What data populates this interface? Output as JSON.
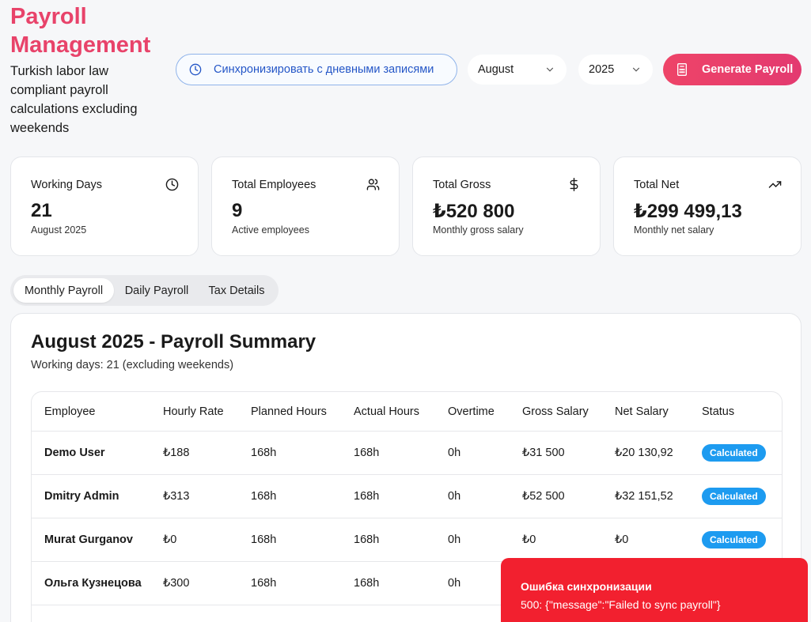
{
  "header": {
    "title": "Payroll Management",
    "subtitle": "Turkish labor law compliant payroll calculations excluding weekends",
    "sync_label": "Синхронизировать с дневными записями",
    "month": "August",
    "year": "2025",
    "generate_label": "Generate Payroll",
    "accent_color": "#e8436a"
  },
  "stats": [
    {
      "label": "Working Days",
      "value": "21",
      "sub": "August 2025",
      "icon": "clock-icon"
    },
    {
      "label": "Total Employees",
      "value": "9",
      "sub": "Active employees",
      "icon": "users-icon"
    },
    {
      "label": "Total Gross",
      "value": "₺520 800",
      "sub": "Monthly gross salary",
      "icon": "dollar-icon"
    },
    {
      "label": "Total Net",
      "value": "₺299 499,13",
      "sub": "Monthly net salary",
      "icon": "trending-up-icon"
    }
  ],
  "tabs": [
    "Monthly Payroll",
    "Daily Payroll",
    "Tax Details"
  ],
  "summary": {
    "title": "August 2025 - Payroll Summary",
    "subtitle": "Working days: 21 (excluding weekends)",
    "columns": [
      "Employee",
      "Hourly Rate",
      "Planned Hours",
      "Actual Hours",
      "Overtime",
      "Gross Salary",
      "Net Salary",
      "Status"
    ],
    "rows": [
      [
        "Demo User",
        "₺188",
        "168h",
        "168h",
        "0h",
        "₺31 500",
        "₺20 130,92",
        "Calculated"
      ],
      [
        "Dmitry Admin",
        "₺313",
        "168h",
        "168h",
        "0h",
        "₺52 500",
        "₺32 151,52",
        "Calculated"
      ],
      [
        "Murat Gurganov",
        "₺0",
        "168h",
        "168h",
        "0h",
        "₺0",
        "₺0",
        "Calculated"
      ],
      [
        "Ольга Кузнецова",
        "₺300",
        "168h",
        "168h",
        "0h",
        "",
        "",
        ""
      ]
    ]
  },
  "toast": {
    "title": "Ошибка синхронизации",
    "message": "500: {\"message\":\"Failed to sync payroll\"}",
    "color": "#f2202f"
  }
}
